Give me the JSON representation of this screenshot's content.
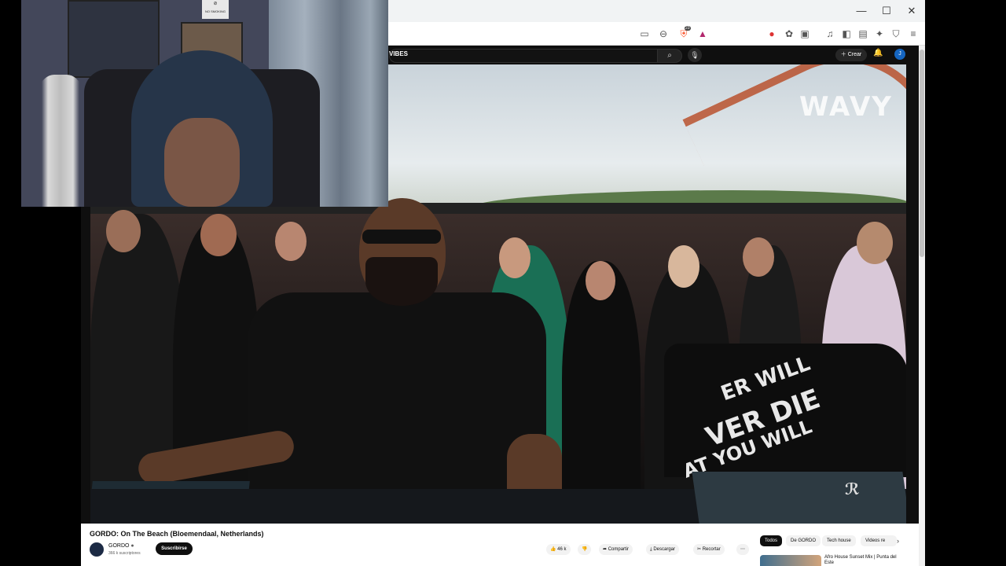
{
  "window_controls": {
    "minimize": "—",
    "maximize": "☐",
    "close": "✕"
  },
  "toolbar": {
    "shield_badge": "23"
  },
  "header": {
    "channel_fragment": "VIBES",
    "create_label": "Crear",
    "avatar_letter": "J"
  },
  "video": {
    "watermark": "WAVY",
    "shirt_lines": [
      "ER WILL",
      "VER DIE",
      "AT YOU WILL"
    ]
  },
  "info": {
    "title": "GORDO: On The Beach (Bloemendaal, Netherlands)",
    "channel_name": "GORDO",
    "subscribers": "366 k suscriptores",
    "subscribe_label": "Suscribirse",
    "likes": "46 k",
    "share_label": "Compartir",
    "download_label": "Descargar",
    "clip_label": "Recortar",
    "more_label": "⋯"
  },
  "chips": [
    {
      "label": "Todos",
      "active": true
    },
    {
      "label": "De GORDO",
      "active": false
    },
    {
      "label": "Tech house",
      "active": false
    },
    {
      "label": "Videos re",
      "active": false
    }
  ],
  "recommendation": {
    "title": "Afro House Sunset Mix | Punta del Este"
  },
  "webcam": {
    "sign_text": "NO SMOKING"
  }
}
